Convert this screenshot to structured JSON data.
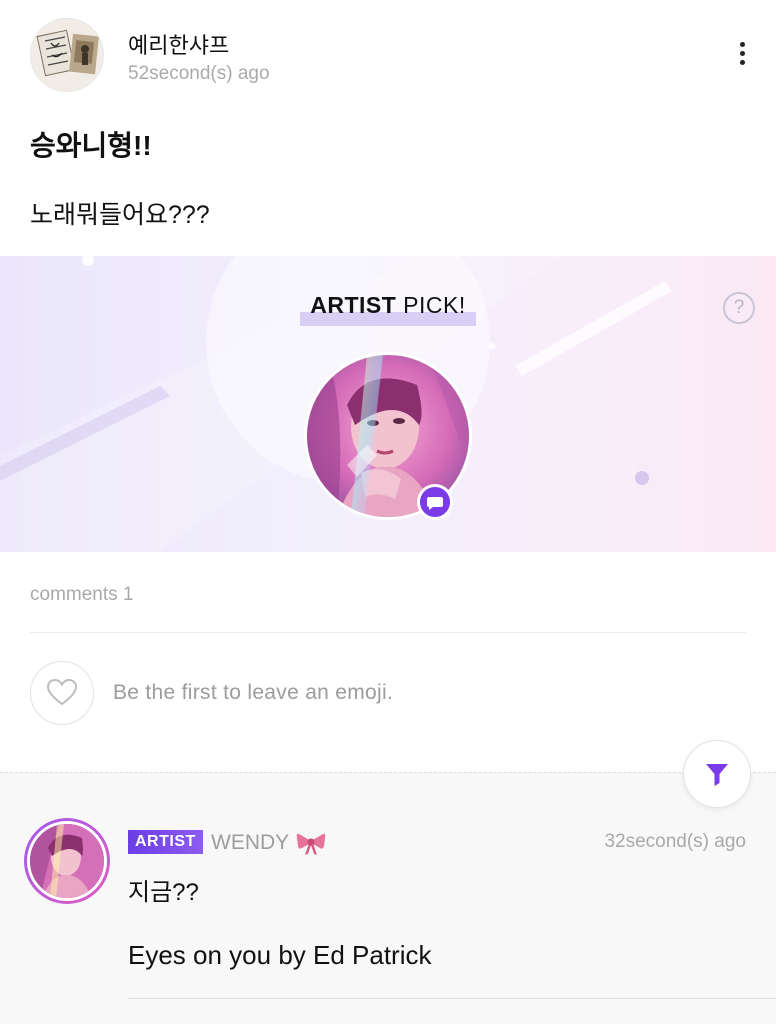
{
  "post": {
    "author": "예리한샤프",
    "time": "52second(s) ago",
    "title": "승와니형!!",
    "body": "노래뭐들어요???"
  },
  "banner": {
    "title_bold": "ARTIST",
    "title_rest": " PICK!",
    "help": "?"
  },
  "comments": {
    "count_label": "comments 1",
    "emoji_prompt": "Be the first to leave an emoji."
  },
  "comment": {
    "badge": "ARTIST",
    "name": "WENDY",
    "time": "32second(s) ago",
    "line1": "지금??",
    "line2": "Eyes on you by Ed Patrick"
  },
  "icons": {
    "more": "more-vertical-icon",
    "help": "question-circle-icon",
    "chat": "chat-bubble-icon",
    "heart": "heart-outline-icon",
    "filter": "filter-icon",
    "bow": "ribbon-bow-icon"
  },
  "colors": {
    "accent": "#7c3be8",
    "badge": "#6b3ee6",
    "muted_text": "#a9a9a9"
  }
}
